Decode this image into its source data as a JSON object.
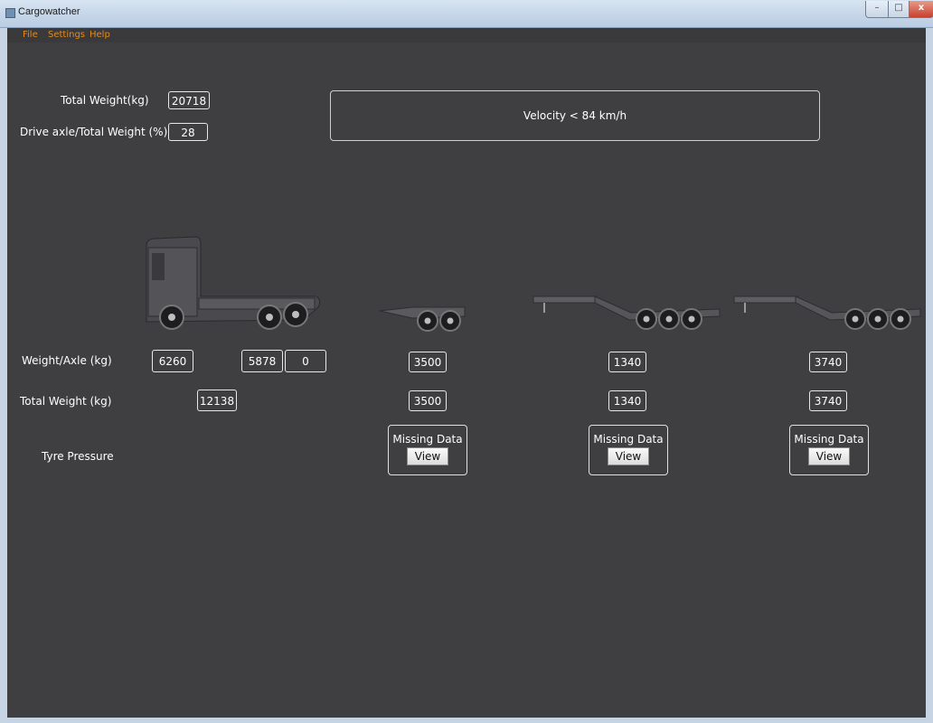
{
  "window": {
    "title": "Cargowatcher",
    "min": "–",
    "max": "□",
    "close": "x"
  },
  "menu": [
    "File",
    "Settings",
    "Help"
  ],
  "summary": {
    "total_weight_label": "Total Weight(kg)",
    "total_weight": "20718",
    "drive_axle_label": "Drive axle/Total Weight (%)",
    "drive_axle": "28"
  },
  "velocity": "Velocity < 84 km/h",
  "rows": {
    "weight_axle_label": "Weight/Axle (kg)",
    "total_weight_label": "Total Weight (kg)",
    "tyre_pressure_label": "Tyre Pressure"
  },
  "tractor": {
    "axles": [
      "6260",
      "5878",
      "0"
    ],
    "total": "12138"
  },
  "trailers": [
    {
      "axle": "3500",
      "total": "3500",
      "tyre_status": "Missing Data",
      "view": "View"
    },
    {
      "axle": "1340",
      "total": "1340",
      "tyre_status": "Missing Data",
      "view": "View"
    },
    {
      "axle": "3740",
      "total": "3740",
      "tyre_status": "Missing Data",
      "view": "View"
    }
  ],
  "colors": {
    "background": "#3f3f42",
    "menu_text": "#e28a20",
    "text": "#ffffff"
  }
}
